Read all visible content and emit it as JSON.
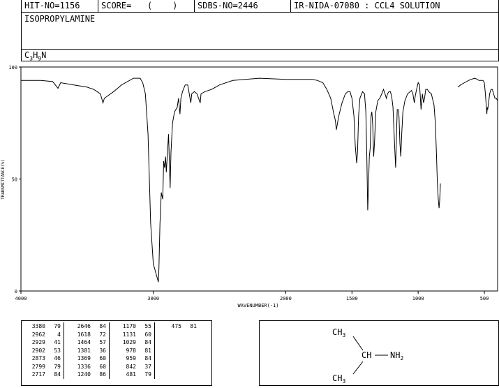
{
  "header": {
    "hit_no": "HIT-NO=1156",
    "score_label": "SCORE=",
    "score_value": "(    )",
    "sdbs_no": "SDBS-NO=2446",
    "ir_id": "IR-NIDA-07080 : CCL4 SOLUTION"
  },
  "compound": {
    "name": "ISOPROPYLAMINE",
    "formula": {
      "c": "C",
      "c_sub": "3",
      "h": "H",
      "h_sub": "9",
      "n": "N"
    }
  },
  "structure": {
    "top_group": "CH",
    "top_sub": "3",
    "center": "CH",
    "amine": "NH",
    "amine_sub": "2",
    "bottom_group": "CH",
    "bottom_sub": "3"
  },
  "peak_table": {
    "columns": [
      [
        [
          "3380",
          "79"
        ],
        [
          "2962",
          "4"
        ],
        [
          "2929",
          "41"
        ],
        [
          "2902",
          "53"
        ],
        [
          "2873",
          "46"
        ],
        [
          "2799",
          "79"
        ],
        [
          "2717",
          "84"
        ]
      ],
      [
        [
          "2646",
          "84"
        ],
        [
          "1618",
          "72"
        ],
        [
          "1464",
          "57"
        ],
        [
          "1381",
          "36"
        ],
        [
          "1369",
          "60"
        ],
        [
          "1336",
          "60"
        ],
        [
          "1240",
          "86"
        ]
      ],
      [
        [
          "1170",
          "55"
        ],
        [
          "1131",
          "60"
        ],
        [
          "1029",
          "84"
        ],
        [
          "978",
          "81"
        ],
        [
          "959",
          "84"
        ],
        [
          "842",
          "37"
        ],
        [
          "481",
          "79"
        ]
      ],
      [
        [
          "475",
          "81"
        ]
      ]
    ]
  },
  "chart_data": {
    "type": "line",
    "xlabel": "WAVENUMBER(-1)",
    "ylabel": "TRANSMITTANCE(%)",
    "xlim": [
      4000,
      400
    ],
    "ylim": [
      0,
      100
    ],
    "x_ticks": [
      4000,
      3000,
      2000,
      1500,
      1000,
      500
    ],
    "y_ticks": [
      0,
      50,
      100
    ],
    "series": [
      {
        "color": "#000000",
        "points": [
          [
            4000,
            94
          ],
          [
            3850,
            94
          ],
          [
            3760,
            93.5
          ],
          [
            3740,
            92
          ],
          [
            3720,
            90.5
          ],
          [
            3700,
            93
          ],
          [
            3600,
            92
          ],
          [
            3500,
            91
          ],
          [
            3450,
            90
          ],
          [
            3400,
            88
          ],
          [
            3380,
            84
          ],
          [
            3370,
            86
          ],
          [
            3300,
            89
          ],
          [
            3240,
            92
          ],
          [
            3150,
            95
          ],
          [
            3100,
            95
          ],
          [
            3080,
            93
          ],
          [
            3060,
            88
          ],
          [
            3040,
            70
          ],
          [
            3020,
            30
          ],
          [
            3000,
            12
          ],
          [
            2990,
            10
          ],
          [
            2962,
            4
          ],
          [
            2958,
            10
          ],
          [
            2950,
            30
          ],
          [
            2940,
            44
          ],
          [
            2929,
            41
          ],
          [
            2922,
            58
          ],
          [
            2915,
            55
          ],
          [
            2908,
            60
          ],
          [
            2902,
            53
          ],
          [
            2895,
            60
          ],
          [
            2885,
            70
          ],
          [
            2873,
            46
          ],
          [
            2867,
            62
          ],
          [
            2855,
            75
          ],
          [
            2840,
            80
          ],
          [
            2820,
            82
          ],
          [
            2810,
            86
          ],
          [
            2799,
            79
          ],
          [
            2792,
            86
          ],
          [
            2780,
            89
          ],
          [
            2760,
            92
          ],
          [
            2740,
            92
          ],
          [
            2717,
            84
          ],
          [
            2710,
            88
          ],
          [
            2690,
            89
          ],
          [
            2670,
            88
          ],
          [
            2646,
            84
          ],
          [
            2640,
            88
          ],
          [
            2610,
            89
          ],
          [
            2560,
            90
          ],
          [
            2500,
            92
          ],
          [
            2400,
            94
          ],
          [
            2200,
            95
          ],
          [
            2000,
            94.5
          ],
          [
            1900,
            94.5
          ],
          [
            1800,
            94.5
          ],
          [
            1760,
            94
          ],
          [
            1720,
            93
          ],
          [
            1690,
            90
          ],
          [
            1660,
            86
          ],
          [
            1640,
            80
          ],
          [
            1625,
            76
          ],
          [
            1618,
            72
          ],
          [
            1612,
            74
          ],
          [
            1600,
            78
          ],
          [
            1575,
            84
          ],
          [
            1550,
            88
          ],
          [
            1530,
            89
          ],
          [
            1515,
            89
          ],
          [
            1500,
            86
          ],
          [
            1485,
            78
          ],
          [
            1475,
            65
          ],
          [
            1464,
            57
          ],
          [
            1458,
            62
          ],
          [
            1450,
            78
          ],
          [
            1440,
            86
          ],
          [
            1420,
            89
          ],
          [
            1405,
            88
          ],
          [
            1395,
            80
          ],
          [
            1388,
            60
          ],
          [
            1381,
            36
          ],
          [
            1376,
            45
          ],
          [
            1369,
            60
          ],
          [
            1362,
            64
          ],
          [
            1356,
            78
          ],
          [
            1350,
            80
          ],
          [
            1343,
            74
          ],
          [
            1336,
            60
          ],
          [
            1330,
            66
          ],
          [
            1320,
            80
          ],
          [
            1305,
            85
          ],
          [
            1290,
            86
          ],
          [
            1275,
            88
          ],
          [
            1262,
            90
          ],
          [
            1250,
            88
          ],
          [
            1240,
            86
          ],
          [
            1232,
            88
          ],
          [
            1220,
            89
          ],
          [
            1210,
            89
          ],
          [
            1200,
            87
          ],
          [
            1190,
            82
          ],
          [
            1180,
            68
          ],
          [
            1170,
            55
          ],
          [
            1164,
            70
          ],
          [
            1158,
            81
          ],
          [
            1150,
            81
          ],
          [
            1145,
            78
          ],
          [
            1138,
            66
          ],
          [
            1131,
            60
          ],
          [
            1124,
            70
          ],
          [
            1115,
            80
          ],
          [
            1100,
            85
          ],
          [
            1080,
            88
          ],
          [
            1060,
            89
          ],
          [
            1050,
            89.5
          ],
          [
            1040,
            88
          ],
          [
            1029,
            84
          ],
          [
            1022,
            87
          ],
          [
            1012,
            90
          ],
          [
            1000,
            93
          ],
          [
            990,
            92
          ],
          [
            984,
            87
          ],
          [
            978,
            81
          ],
          [
            974,
            84
          ],
          [
            968,
            88
          ],
          [
            959,
            84
          ],
          [
            952,
            86
          ],
          [
            943,
            90
          ],
          [
            930,
            90
          ],
          [
            920,
            89
          ],
          [
            900,
            88
          ],
          [
            880,
            83
          ],
          [
            870,
            75
          ],
          [
            862,
            62
          ],
          [
            855,
            48
          ],
          [
            848,
            41
          ],
          [
            842,
            37
          ],
          [
            838,
            40
          ],
          [
            834,
            45
          ],
          [
            832,
            48
          ],
          null,
          [
            700,
            91
          ],
          [
            680,
            92
          ],
          [
            650,
            93
          ],
          [
            620,
            94
          ],
          [
            600,
            94.5
          ],
          [
            570,
            95
          ],
          [
            540,
            94
          ],
          [
            510,
            94
          ],
          [
            500,
            93
          ],
          [
            492,
            88
          ],
          [
            485,
            82
          ],
          [
            481,
            79
          ],
          [
            478,
            82
          ],
          [
            475,
            81
          ],
          [
            470,
            83
          ],
          [
            460,
            88
          ],
          [
            450,
            90
          ],
          [
            440,
            90
          ],
          [
            430,
            88
          ],
          [
            420,
            86
          ],
          [
            410,
            86
          ],
          [
            400,
            85
          ]
        ]
      }
    ]
  }
}
